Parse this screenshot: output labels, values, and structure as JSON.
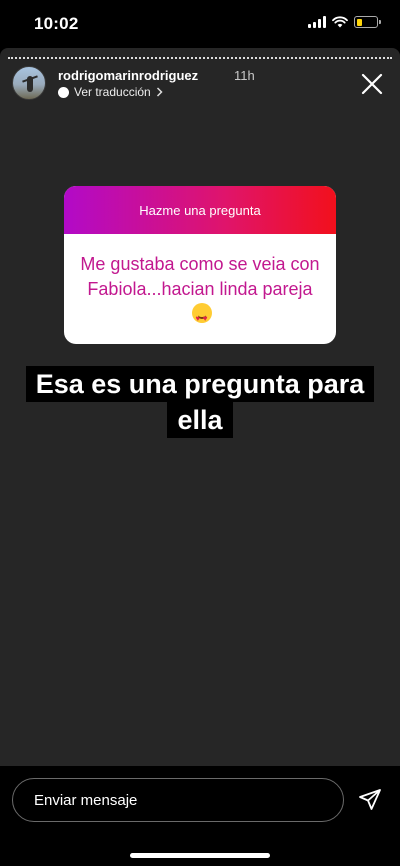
{
  "status_bar": {
    "time": "10:02",
    "signal_icon": "signal-icon",
    "wifi_icon": "wifi-icon",
    "battery_icon": "battery-icon",
    "battery_color": "#ffd60a",
    "battery_level": 0.3
  },
  "story": {
    "username": "rodrigomarinrodriguez",
    "time_ago": "11h",
    "translate_label": "Ver traducción",
    "question_card": {
      "header": "Hazme una pregunta",
      "question": "Me gustaba como se veia con Fabiola...hacian linda pareja",
      "header_gradient": [
        "#b20ac8",
        "#e0146a",
        "#f2101c"
      ],
      "text_color": "#c2188f",
      "emoji_icon": "heart-eyes-emoji"
    },
    "caption_lines": [
      "Esa es una  pregunta para",
      "ella"
    ]
  },
  "reply_bar": {
    "placeholder": "Enviar mensaje",
    "send_icon": "send-icon"
  }
}
